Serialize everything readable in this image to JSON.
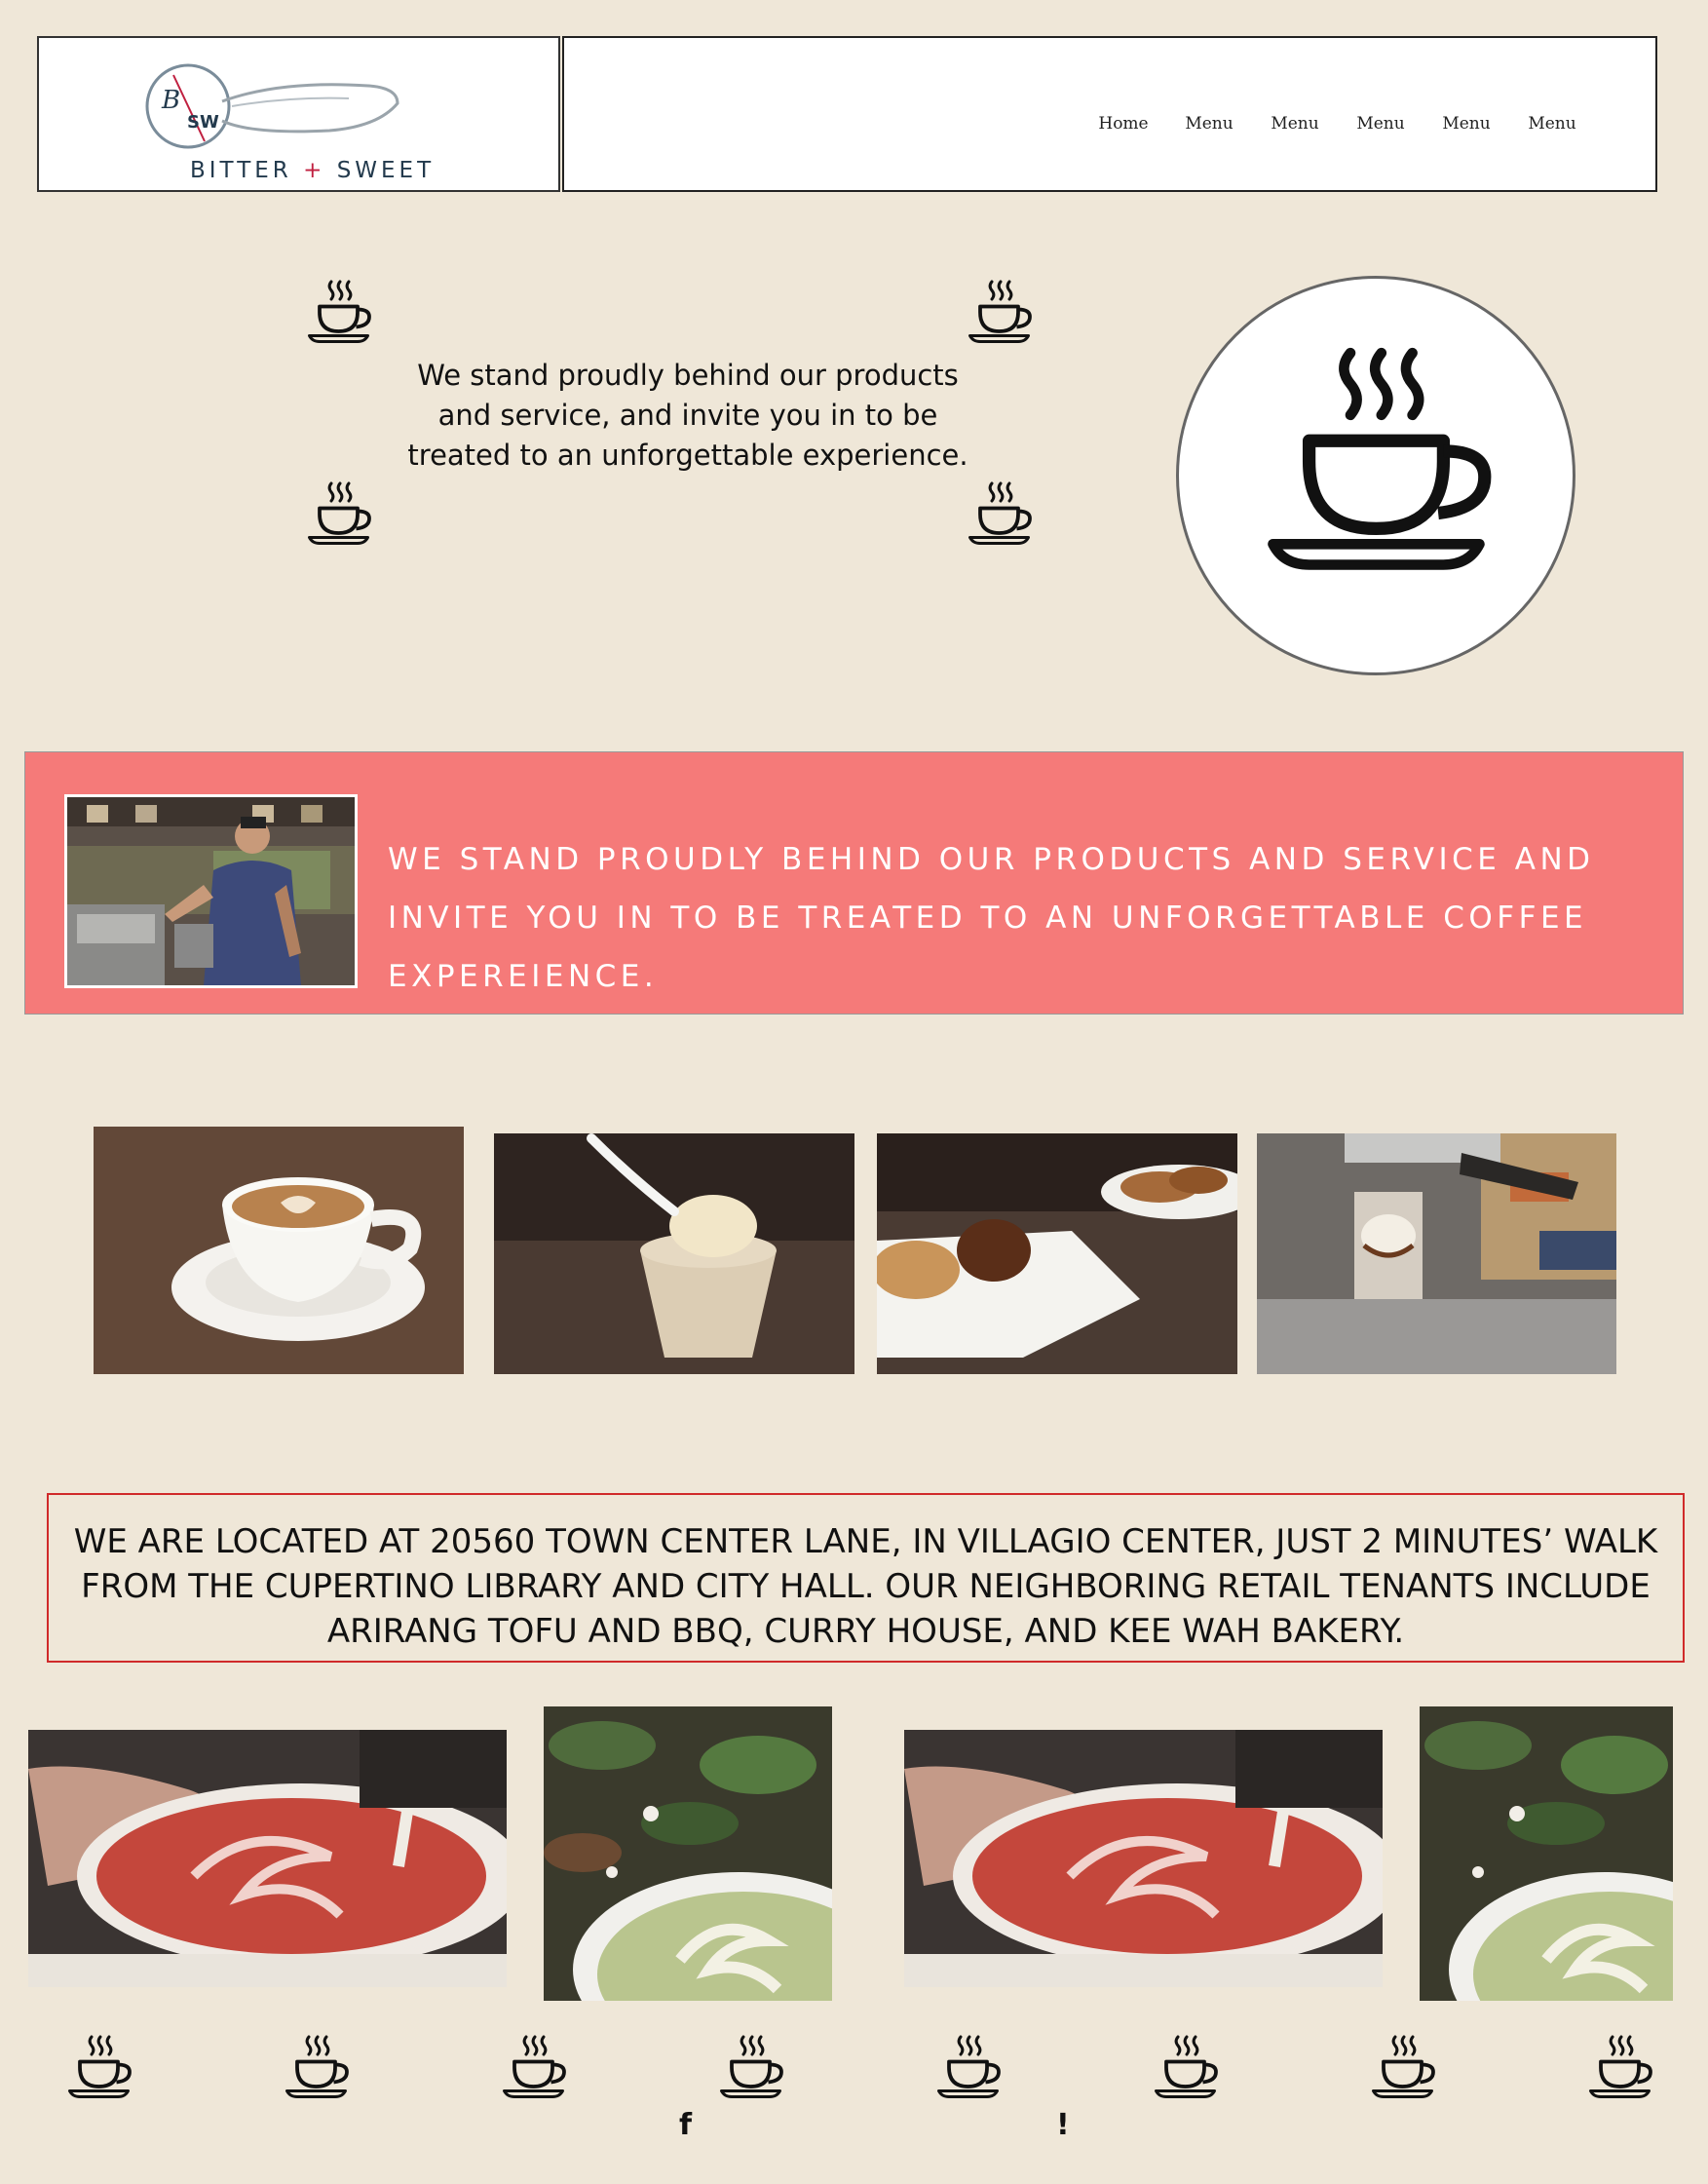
{
  "header": {
    "logo_monogram": "B/SW",
    "logo_name_left": "BITTER",
    "logo_plus": "+",
    "logo_name_right": "SWEET",
    "nav": [
      "Home",
      "Menu",
      "Menu",
      "Menu",
      "Menu",
      "Menu"
    ]
  },
  "intro": {
    "text": "We stand proudly behind our products and service, and invite you in to be treated to an unforgettable experience."
  },
  "banner": {
    "text": "WE STAND PROUDLY BEHIND OUR PRODUCTS AND SERVICE AND INVITE YOU IN TO BE TREATED TO AN UNFORGETTABLE COFFEE EXPEREIENCE.",
    "color": "#f57a79"
  },
  "gallery": [
    "latte-heart-photo",
    "ice-cream-cup-photo",
    "pastries-plate-photo",
    "affogato-espresso-photo"
  ],
  "location": {
    "text": "WE ARE LOCATED AT 20560 TOWN CENTER LANE, IN VILLAGIO CENTER, JUST 2 MINUTES’ WALK FROM THE CUPERTINO LIBRARY AND CITY HALL. OUR NEIGHBORING RETAIL TENANTS INCLUDE ARIRANG TOFU AND BBQ, CURRY HOUSE, AND KEE WAH BAKERY."
  },
  "footer": {
    "facebook_glyph": "f",
    "alert_glyph": "!"
  },
  "colors": {
    "background": "#efe7d8",
    "banner": "#f57a79",
    "location_border": "#d02a2a"
  }
}
